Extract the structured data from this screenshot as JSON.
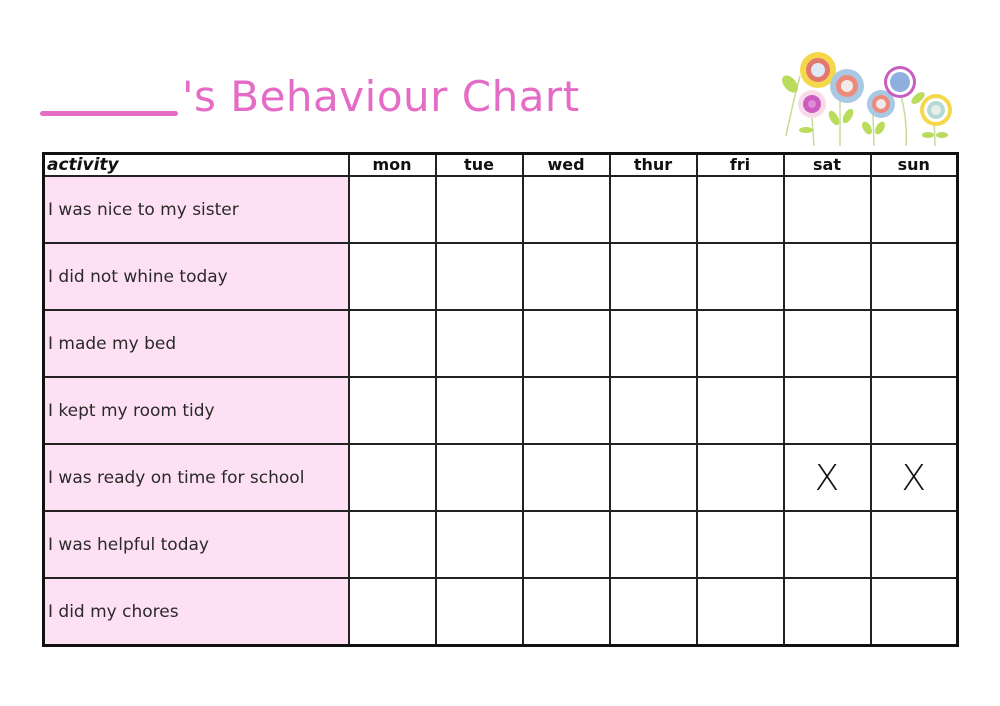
{
  "title": {
    "name_blank": "",
    "text": "'s Behaviour Chart"
  },
  "colors": {
    "title_pink": "#e46bc6",
    "activity_bg": "#fde0f4",
    "grid_line": "#222222"
  },
  "decoration": {
    "icon": "flowers-illustration"
  },
  "table": {
    "activity_header": "activity",
    "days": [
      "mon",
      "tue",
      "wed",
      "thur",
      "fri",
      "sat",
      "sun"
    ],
    "rows": [
      {
        "activity": "I was nice to my sister",
        "marks": [
          "",
          "",
          "",
          "",
          "",
          "",
          ""
        ]
      },
      {
        "activity": "I did not whine today",
        "marks": [
          "",
          "",
          "",
          "",
          "",
          "",
          ""
        ]
      },
      {
        "activity": "I made my bed",
        "marks": [
          "",
          "",
          "",
          "",
          "",
          "",
          ""
        ]
      },
      {
        "activity": "I kept my room tidy",
        "marks": [
          "",
          "",
          "",
          "",
          "",
          "",
          ""
        ]
      },
      {
        "activity": "I was ready on time for school",
        "marks": [
          "",
          "",
          "",
          "",
          "",
          "X",
          "X"
        ]
      },
      {
        "activity": "I was helpful today",
        "marks": [
          "",
          "",
          "",
          "",
          "",
          "",
          ""
        ]
      },
      {
        "activity": "I did my chores",
        "marks": [
          "",
          "",
          "",
          "",
          "",
          "",
          ""
        ]
      }
    ]
  }
}
